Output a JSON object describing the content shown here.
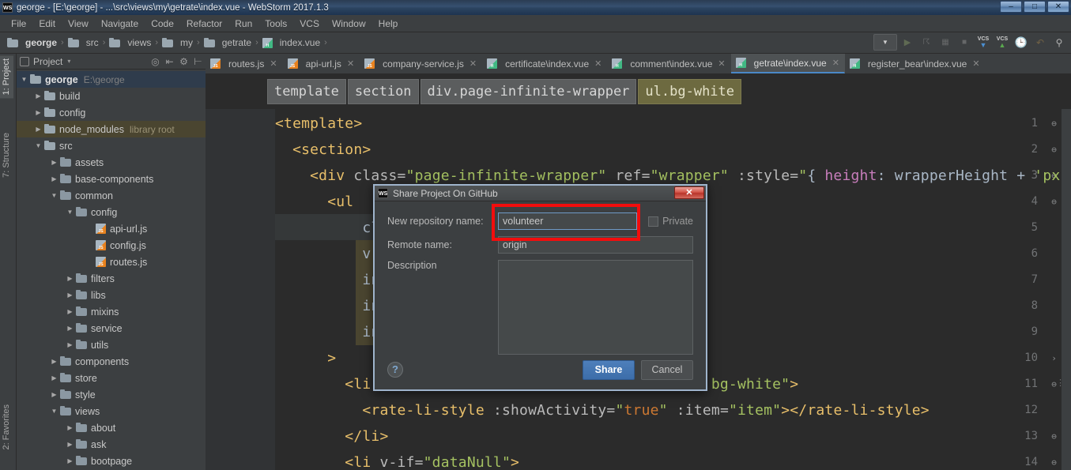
{
  "window": {
    "title": "george - [E:\\george] - ...\\src\\views\\my\\getrate\\index.vue - WebStorm 2017.1.3",
    "ws_icon": "WS",
    "minimize": "–",
    "maximize": "□",
    "close": "✕"
  },
  "menu": {
    "items": [
      "File",
      "Edit",
      "View",
      "Navigate",
      "Code",
      "Refactor",
      "Run",
      "Tools",
      "VCS",
      "Window",
      "Help"
    ]
  },
  "navbar": {
    "crumbs": [
      {
        "label": "george",
        "icon": "folder-icon"
      },
      {
        "label": "src",
        "icon": "folder-icon"
      },
      {
        "label": "views",
        "icon": "folder-icon"
      },
      {
        "label": "my",
        "icon": "folder-icon"
      },
      {
        "label": "getrate",
        "icon": "folder-icon"
      },
      {
        "label": "index.vue",
        "icon": "vue-file-icon"
      }
    ],
    "separator": "›",
    "right_tools": [
      {
        "name": "run-configuration-selector",
        "glyph": "▼"
      },
      {
        "name": "run-button",
        "glyph": "▶"
      },
      {
        "name": "debug-button",
        "glyph": "🐞"
      },
      {
        "name": "coverage-button",
        "glyph": "☰"
      },
      {
        "name": "stop-button",
        "glyph": "■"
      },
      {
        "name": "vcs-update-button",
        "glyph": "VCS"
      },
      {
        "name": "vcs-commit-button",
        "glyph": "VCS"
      },
      {
        "name": "vcs-history-button",
        "glyph": "◴"
      },
      {
        "name": "undo-button",
        "glyph": "↶"
      },
      {
        "name": "search-everywhere-button",
        "glyph": "⌕"
      }
    ]
  },
  "toolstrip": {
    "tabs": [
      {
        "label": "1: Project",
        "active": true
      },
      {
        "label": "7: Structure",
        "active": false
      },
      {
        "label": "2: Favorites",
        "active": false
      }
    ]
  },
  "project_panel": {
    "title": "Project",
    "caret": "▾",
    "icons": [
      "target-icon",
      "collapse-all-icon",
      "settings-gear-icon",
      "hide-panel-icon"
    ]
  },
  "tree": {
    "nodes": [
      {
        "label": "george",
        "path": "E:\\george",
        "indent": 0,
        "arrow": "▼",
        "icon": "folder-icon",
        "bold": true,
        "selected": true
      },
      {
        "label": "build",
        "path": "",
        "indent": 1,
        "arrow": "▶",
        "icon": "folder-icon"
      },
      {
        "label": "config",
        "path": "",
        "indent": 1,
        "arrow": "▶",
        "icon": "folder-icon"
      },
      {
        "label": "node_modules",
        "path": "library root",
        "indent": 1,
        "arrow": "▶",
        "icon": "folder-icon",
        "libroot": true
      },
      {
        "label": "src",
        "path": "",
        "indent": 1,
        "arrow": "▼",
        "icon": "folder-icon"
      },
      {
        "label": "assets",
        "path": "",
        "indent": 2,
        "arrow": "▶",
        "icon": "folder-icon"
      },
      {
        "label": "base-components",
        "path": "",
        "indent": 2,
        "arrow": "▶",
        "icon": "folder-icon"
      },
      {
        "label": "common",
        "path": "",
        "indent": 2,
        "arrow": "▼",
        "icon": "folder-icon"
      },
      {
        "label": "config",
        "path": "",
        "indent": 3,
        "arrow": "▼",
        "icon": "folder-icon"
      },
      {
        "label": "api-url.js",
        "path": "",
        "indent": 4,
        "arrow": "",
        "icon": "js-file-icon"
      },
      {
        "label": "config.js",
        "path": "",
        "indent": 4,
        "arrow": "",
        "icon": "js-file-icon"
      },
      {
        "label": "routes.js",
        "path": "",
        "indent": 4,
        "arrow": "",
        "icon": "js-file-icon"
      },
      {
        "label": "filters",
        "path": "",
        "indent": 3,
        "arrow": "▶",
        "icon": "folder-icon"
      },
      {
        "label": "libs",
        "path": "",
        "indent": 3,
        "arrow": "▶",
        "icon": "folder-icon"
      },
      {
        "label": "mixins",
        "path": "",
        "indent": 3,
        "arrow": "▶",
        "icon": "folder-icon"
      },
      {
        "label": "service",
        "path": "",
        "indent": 3,
        "arrow": "▶",
        "icon": "folder-icon"
      },
      {
        "label": "utils",
        "path": "",
        "indent": 3,
        "arrow": "▶",
        "icon": "folder-icon"
      },
      {
        "label": "components",
        "path": "",
        "indent": 2,
        "arrow": "▶",
        "icon": "folder-icon"
      },
      {
        "label": "store",
        "path": "",
        "indent": 2,
        "arrow": "▶",
        "icon": "folder-icon"
      },
      {
        "label": "style",
        "path": "",
        "indent": 2,
        "arrow": "▶",
        "icon": "folder-icon"
      },
      {
        "label": "views",
        "path": "",
        "indent": 2,
        "arrow": "▼",
        "icon": "folder-icon"
      },
      {
        "label": "about",
        "path": "",
        "indent": 3,
        "arrow": "▶",
        "icon": "folder-icon"
      },
      {
        "label": "ask",
        "path": "",
        "indent": 3,
        "arrow": "▶",
        "icon": "folder-icon"
      },
      {
        "label": "bootpage",
        "path": "",
        "indent": 3,
        "arrow": "▶",
        "icon": "folder-icon"
      }
    ]
  },
  "editor": {
    "tabs": [
      {
        "label": "routes.js",
        "icon": "js-file-icon",
        "active": false,
        "close": "✕"
      },
      {
        "label": "api-url.js",
        "icon": "js-file-icon",
        "active": false,
        "close": "✕"
      },
      {
        "label": "company-service.js",
        "icon": "js-file-icon",
        "active": false,
        "close": "✕"
      },
      {
        "label": "certificate\\index.vue",
        "icon": "vue-file-icon",
        "active": false,
        "close": "✕"
      },
      {
        "label": "comment\\index.vue",
        "icon": "vue-file-icon",
        "active": false,
        "close": "✕"
      },
      {
        "label": "getrate\\index.vue",
        "icon": "vue-file-icon",
        "active": true,
        "close": "✕"
      },
      {
        "label": "register_bear\\index.vue",
        "icon": "vue-file-icon",
        "active": false,
        "close": "✕"
      }
    ],
    "breadcrumbs": [
      {
        "label": "template",
        "highlight": false
      },
      {
        "label": "section",
        "highlight": false
      },
      {
        "label": "div.page-infinite-wrapper",
        "highlight": false
      },
      {
        "label": "ul.bg-white",
        "highlight": true
      }
    ],
    "line_numbers": [
      "1",
      "2",
      "3",
      "4",
      "5",
      "6",
      "7",
      "8",
      "9",
      "10",
      "11",
      "12",
      "13",
      "14"
    ],
    "lines": [
      {
        "n": "1",
        "fold": "⊖",
        "text": "<template>"
      },
      {
        "n": "2",
        "fold": "⊖",
        "text": "  <section>"
      },
      {
        "n": "3",
        "fold": "⊖",
        "text": "    <div class=\"page-infinite-wrapper\" ref=\"wrapper\" :style=\"{ height: wrapperHeight + 'px'"
      },
      {
        "n": "4",
        "fold": "⊖",
        "text": "      <ul"
      },
      {
        "n": "5",
        "fold": "",
        "text": "          cla"
      },
      {
        "n": "6",
        "fold": "",
        "text": "          v-i"
      },
      {
        "n": "7",
        "fold": "",
        "text": "          inf"
      },
      {
        "n": "8",
        "fold": "",
        "text": "          inf"
      },
      {
        "n": "9",
        "fold": "",
        "text": "          inf"
      },
      {
        "n": "10",
        "fold": "›",
        "text": "      >"
      },
      {
        "n": "11",
        "fold": "⊖",
        "text": "        <li                                      bg-white\">"
      },
      {
        "n": "12",
        "fold": "",
        "text": "          <rate-li-style :showActivity=\"true\" :item=\"item\"></rate-li-style>"
      },
      {
        "n": "13",
        "fold": "⊖",
        "text": "        </li>"
      },
      {
        "n": "14",
        "fold": "⊖",
        "text": "        <li v-if=\"dataNull\">"
      }
    ]
  },
  "dialog": {
    "ws_icon": "WS",
    "title": "Share Project On GitHub",
    "close_label": "✕",
    "repo_label": "New repository name:",
    "repo_value": "volunteer",
    "private_label": "Private",
    "private_checked": false,
    "remote_label": "Remote name:",
    "remote_value": "origin",
    "description_label": "Description",
    "description_value": "",
    "help_label": "?",
    "share_button": "Share",
    "cancel_button": "Cancel"
  },
  "annotation": {
    "highlight_color": "#f20d0d",
    "target": "repo-name-field"
  }
}
